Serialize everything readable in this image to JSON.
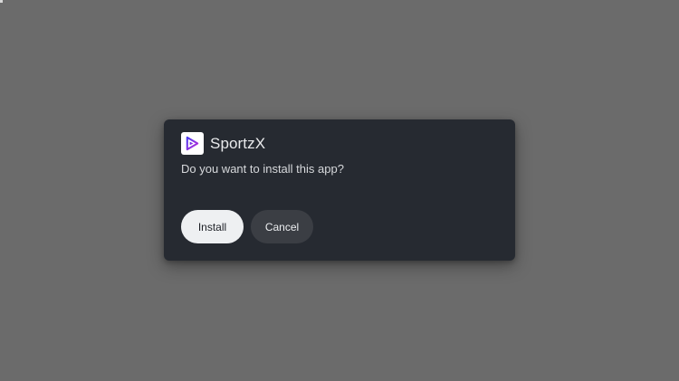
{
  "dialog": {
    "app_icon": "sportzx-play-logo-icon",
    "app_name": "SportzX",
    "message": "Do you want to install this app?",
    "install_label": "Install",
    "cancel_label": "Cancel"
  },
  "colors": {
    "backdrop": "#6b6b6b",
    "dialog_bg": "#262a31",
    "install_bg": "#eef0f2",
    "cancel_bg": "#3b3e44",
    "logo_accent": "#8a2be2"
  }
}
